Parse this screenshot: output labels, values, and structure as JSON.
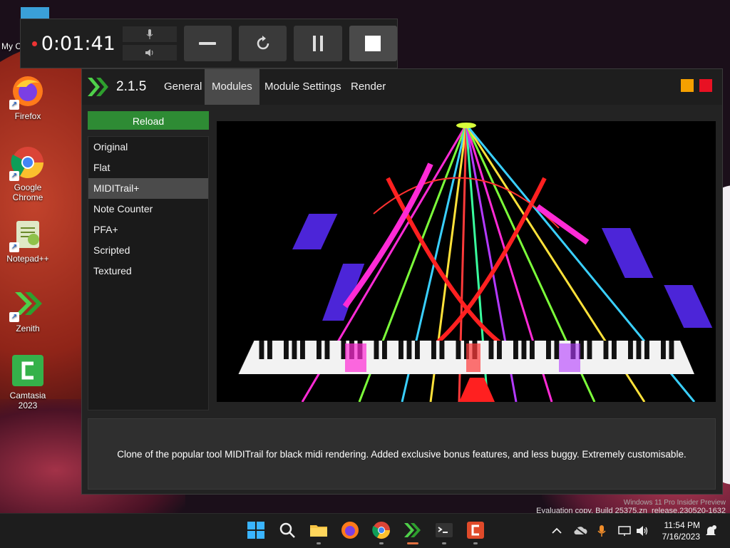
{
  "desktop": {
    "icons": [
      {
        "label": "My C"
      },
      {
        "label": "Firefox"
      },
      {
        "label": "Google Chrome"
      },
      {
        "label": "Notepad++"
      },
      {
        "label": "Zenith"
      },
      {
        "label": "Camtasia 2023"
      }
    ],
    "watermark_line1": "Windows 11 Pro Insider Preview",
    "watermark_line2": "Evaluation copy. Build 25375.zn_release.230520-1632"
  },
  "recorder": {
    "time": "0:01:41"
  },
  "app": {
    "version": "2.1.5",
    "tabs": [
      {
        "label": "General"
      },
      {
        "label": "Modules"
      },
      {
        "label": "Module Settings"
      },
      {
        "label": "Render"
      }
    ],
    "active_tab": "Modules",
    "reload_label": "Reload",
    "modules": [
      {
        "label": "Original"
      },
      {
        "label": "Flat"
      },
      {
        "label": "MIDITrail+"
      },
      {
        "label": "Note Counter"
      },
      {
        "label": "PFA+"
      },
      {
        "label": "Scripted"
      },
      {
        "label": "Textured"
      }
    ],
    "selected_module": "MIDITrail+",
    "description": "Clone of the popular tool MIDITrail for black midi rendering. Added exclusive bonus features, and less buggy. Extremely customisable.",
    "colors": {
      "accent_green": "#2e8b34",
      "minimize": "#f5a000",
      "close": "#e81123"
    }
  },
  "taskbar": {
    "time": "11:54 PM",
    "date": "7/16/2023"
  }
}
